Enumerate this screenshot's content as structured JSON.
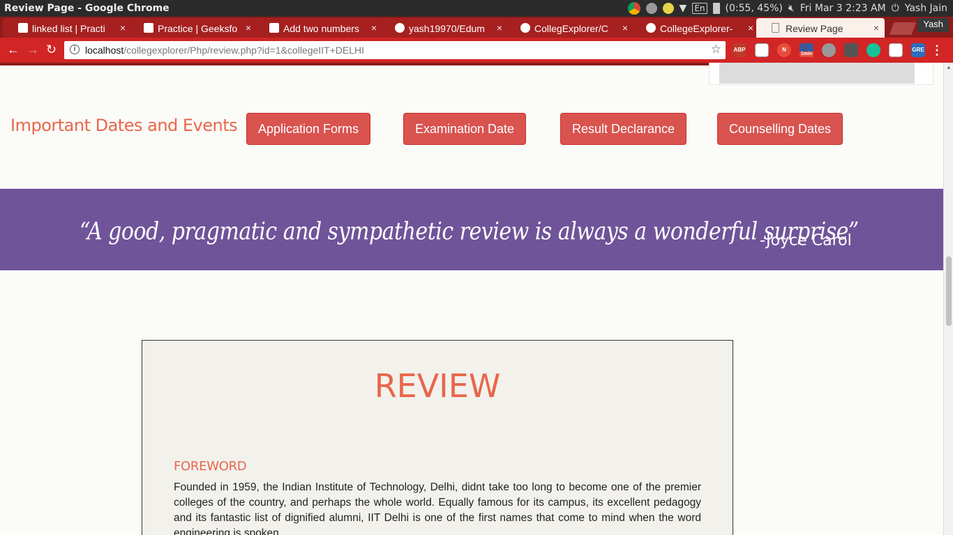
{
  "os": {
    "window_title": "Review Page - Google Chrome",
    "battery": "(0:55, 45%)",
    "language": "En",
    "datetime": "Fri Mar  3  2:23 AM",
    "user": "Yash Jain"
  },
  "tabs": [
    {
      "label": "linked list | Practi",
      "icon": "gfg-icon"
    },
    {
      "label": "Practice | Geeksfo",
      "icon": "gfg-icon"
    },
    {
      "label": "Add two numbers",
      "icon": "gfg-icon"
    },
    {
      "label": "yash19970/Edum",
      "icon": "github-icon"
    },
    {
      "label": "CollegExplorer/C",
      "icon": "github-icon"
    },
    {
      "label": "CollegeExplorer-",
      "icon": "github-icon"
    },
    {
      "label": "Review Page",
      "icon": "page-icon",
      "active": true
    }
  ],
  "tab_close_glyph": "×",
  "profile_label": "Yash",
  "omnibox": {
    "host": "localhost",
    "path": "/collegexplorer/Php/review.php?id=1&collegeIIT+DELHI"
  },
  "extensions": {
    "abp": "ABP",
    "timer_badge": "1min",
    "n_label": "N",
    "gre_label": "GRE"
  },
  "dates_section": {
    "title": "Important Dates and Events",
    "buttons": [
      "Application Forms",
      "Examination Date",
      "Result Declarance",
      "Counselling Dates"
    ]
  },
  "quote": {
    "text": "“A good, pragmatic and sympathetic review is always a wonderful surprise”",
    "author": "-Joyce Carol"
  },
  "review": {
    "title": "REVIEW",
    "foreword_heading": "FOREWORD",
    "foreword_body": "Founded in 1959, the Indian Institute of Technology, Delhi, didnt take too long to become one of the premier colleges of the country, and perhaps the whole world. Equally famous for its campus, its excellent pedagogy and its fantastic list of dignified alumni, IIT Delhi is one of the first names that come to mind when the word engineering is spoken."
  },
  "colors": {
    "accent": "#e8664b",
    "button": "#d9534f",
    "quote_band": "#6f5499",
    "toolbar": "#d22525"
  }
}
